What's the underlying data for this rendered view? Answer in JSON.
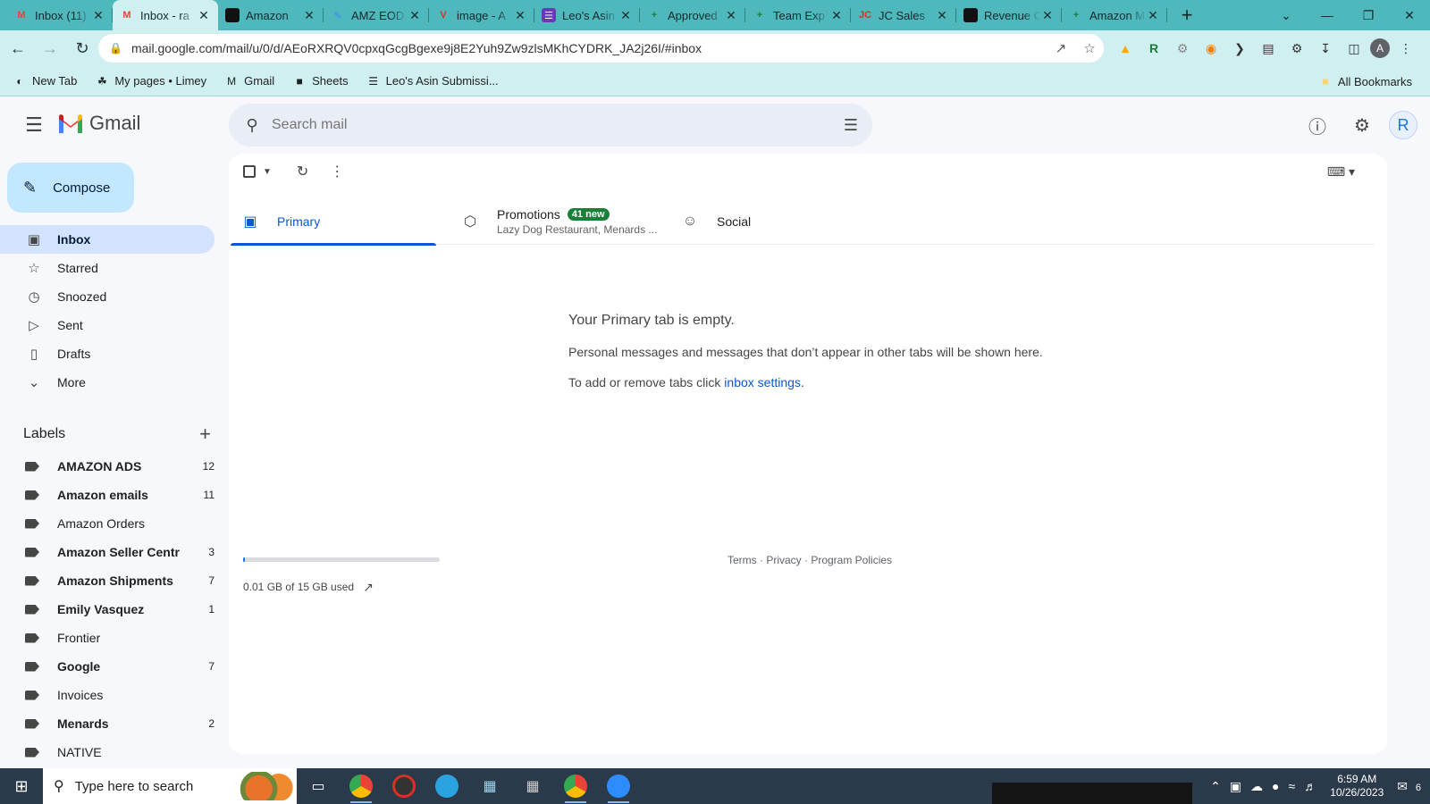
{
  "browser": {
    "tabs": [
      {
        "title": "Inbox (11)",
        "favicon": "gmail",
        "color": "#4fb8bd",
        "icon_text": "M",
        "icon_color": "#ea4335",
        "active": false
      },
      {
        "title": "Inbox - ra",
        "favicon": "gmail",
        "color": "#cfeff0",
        "icon_text": "M",
        "icon_color": "#ea4335",
        "active": true
      },
      {
        "title": "Amazon",
        "favicon": "amazon",
        "icon_text": "a",
        "icon_color": "#111111",
        "active": false
      },
      {
        "title": "AMZ EOD",
        "favicon": "pen",
        "icon_text": "✎",
        "icon_color": "#4285f4",
        "active": false
      },
      {
        "title": "image - A",
        "favicon": "vivaldi",
        "icon_text": "V",
        "icon_color": "#d93025",
        "active": false
      },
      {
        "title": "Leo's Asin",
        "favicon": "form",
        "icon_text": "☰",
        "icon_color": "#ffffff",
        "active": false
      },
      {
        "title": "Approved",
        "favicon": "sheets",
        "icon_text": "+",
        "icon_color": "#188038",
        "active": false
      },
      {
        "title": "Team Exp",
        "favicon": "sheets",
        "icon_text": "+",
        "icon_color": "#188038",
        "active": false
      },
      {
        "title": "JC Sales",
        "favicon": "jc",
        "icon_text": "JC",
        "icon_color": "#d93025",
        "active": false
      },
      {
        "title": "Revenue C",
        "favicon": "amazon",
        "icon_text": "a",
        "icon_color": "#111111",
        "active": false
      },
      {
        "title": "Amazon M",
        "favicon": "sheets",
        "icon_text": "+",
        "icon_color": "#188038",
        "active": false
      }
    ],
    "url": "mail.google.com/mail/u/0/d/AEoRXRQV0cpxqGcgBgexe9j8E2Yuh9Zw9zlsMKhCYDRK_JA2j26I/#inbox",
    "bookmarks": [
      {
        "label": "New Tab",
        "icon": "globe-icon",
        "glyph": "◐"
      },
      {
        "label": "My pages • Limey",
        "icon": "leaf-icon",
        "glyph": "☘"
      },
      {
        "label": "Gmail",
        "icon": "gmail-icon",
        "glyph": "M"
      },
      {
        "label": "Sheets",
        "icon": "folder-icon",
        "glyph": "■"
      },
      {
        "label": "Leo's Asin Submissi...",
        "icon": "form-icon",
        "glyph": "☰"
      }
    ],
    "all_bookmarks": "All Bookmarks",
    "profile_letter": "A"
  },
  "gmail": {
    "app_name": "Gmail",
    "search_placeholder": "Search mail",
    "user_initial": "R",
    "compose_label": "Compose",
    "nav": [
      {
        "label": "Inbox",
        "icon": "inbox-icon",
        "glyph": "▣",
        "active": true
      },
      {
        "label": "Starred",
        "icon": "star-icon",
        "glyph": "☆",
        "active": false
      },
      {
        "label": "Snoozed",
        "icon": "clock-icon",
        "glyph": "◷",
        "active": false
      },
      {
        "label": "Sent",
        "icon": "send-icon",
        "glyph": "▷",
        "active": false
      },
      {
        "label": "Drafts",
        "icon": "draft-icon",
        "glyph": "▯",
        "active": false
      },
      {
        "label": "More",
        "icon": "chevron-down-icon",
        "glyph": "⌄",
        "active": false
      }
    ],
    "labels_title": "Labels",
    "labels": [
      {
        "name": "AMAZON ADS",
        "count": "12",
        "bold": true
      },
      {
        "name": "Amazon emails",
        "count": "11",
        "bold": true
      },
      {
        "name": "Amazon Orders",
        "count": "",
        "bold": false
      },
      {
        "name": "Amazon Seller Centr",
        "count": "3",
        "bold": true
      },
      {
        "name": "Amazon Shipments",
        "count": "7",
        "bold": true
      },
      {
        "name": "Emily Vasquez",
        "count": "1",
        "bold": true
      },
      {
        "name": "Frontier",
        "count": "",
        "bold": false
      },
      {
        "name": "Google",
        "count": "7",
        "bold": true
      },
      {
        "name": "Invoices",
        "count": "",
        "bold": false
      },
      {
        "name": "Menards",
        "count": "2",
        "bold": true
      },
      {
        "name": "NATIVE",
        "count": "",
        "bold": false
      }
    ],
    "inbox_tabs": [
      {
        "name": "Primary",
        "icon": "inbox-tab-icon",
        "glyph": "▣",
        "active": true,
        "badge": "",
        "sub": ""
      },
      {
        "name": "Promotions",
        "icon": "tag-icon",
        "glyph": "⬡",
        "active": false,
        "badge": "41 new",
        "sub": "Lazy Dog Restaurant, Menards ..."
      },
      {
        "name": "Social",
        "icon": "people-icon",
        "glyph": "☺",
        "active": false,
        "badge": "",
        "sub": ""
      }
    ],
    "empty": {
      "title": "Your Primary tab is empty.",
      "line1": "Personal messages and messages that don’t appear in other tabs will be shown here.",
      "line2_prefix": "To add or remove tabs click ",
      "line2_link": "inbox settings",
      "line2_suffix": "."
    },
    "storage": {
      "text": "0.01 GB of 15 GB used",
      "fraction": 0.001
    },
    "footer": "Terms · Privacy · Program Policies"
  },
  "taskbar": {
    "search_placeholder": "Type here to search",
    "time": "6:59 AM",
    "date": "10/26/2023",
    "notification_count": "6"
  },
  "colors": {
    "accent": "#0b57d0",
    "compose_bg": "#c2e7ff",
    "active_nav": "#d3e3fd",
    "badge": "#188038",
    "browser_frame": "#4fb8bd"
  }
}
